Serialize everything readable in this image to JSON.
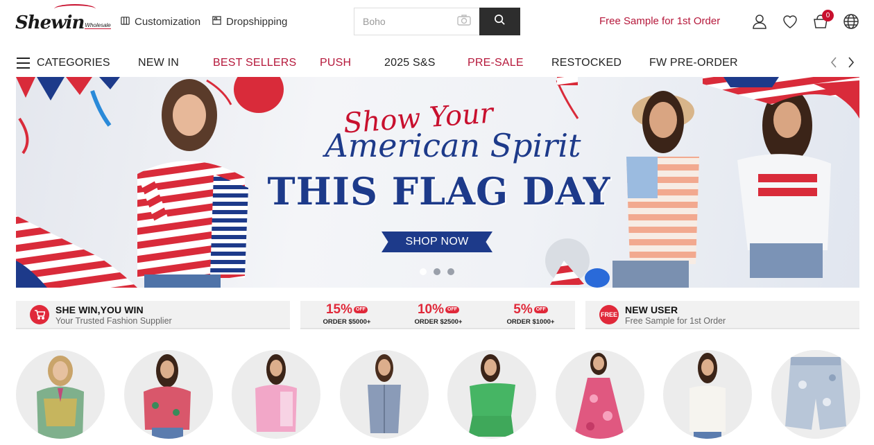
{
  "header": {
    "logo": {
      "main": "Shewin",
      "sub": "Wholesale"
    },
    "links": [
      {
        "label": "Customization",
        "icon": "shirt-icon"
      },
      {
        "label": "Dropshipping",
        "icon": "box-icon"
      }
    ],
    "search": {
      "placeholder": "Boho"
    },
    "free_sample": "Free Sample for 1st Order",
    "cart_count": "0",
    "icons": [
      "user-icon",
      "heart-icon",
      "cart-icon",
      "globe-icon"
    ]
  },
  "nav": {
    "categories_label": "CATEGORIES",
    "items": [
      {
        "label": "NEW IN",
        "highlight": false
      },
      {
        "label": "BEST SELLERS",
        "highlight": true
      },
      {
        "label": "PUSH",
        "highlight": true
      },
      {
        "label": "2025 S&S",
        "highlight": false
      },
      {
        "label": "PRE-SALE",
        "highlight": true
      },
      {
        "label": "RESTOCKED",
        "highlight": false
      },
      {
        "label": "FW PRE-ORDER",
        "highlight": false
      }
    ]
  },
  "banner": {
    "script_line": "Show Your",
    "spirit_line": "American Spirit",
    "headline": "THIS FLAG DAY",
    "cta": "SHOP NOW",
    "slides": 3,
    "active_slide": 1
  },
  "promos": {
    "left": {
      "title": "SHE WIN,YOU WIN",
      "subtitle": "Your Trusted Fashion Supplier",
      "icon": "cart-icon"
    },
    "discounts": [
      {
        "percent": "15%",
        "off": "OFF",
        "order": "ORDER $5000+"
      },
      {
        "percent": "10%",
        "off": "OFF",
        "order": "ORDER $2500+"
      },
      {
        "percent": "5%",
        "off": "OFF",
        "order": "ORDER $1000+"
      }
    ],
    "right": {
      "title": "NEW USER",
      "subtitle": "Free Sample for 1st Order",
      "icon_text": "FREE"
    }
  },
  "colors": {
    "brand_red": "#b5173a",
    "accent_red": "#e0293a",
    "navy": "#1d3a8a",
    "dark": "#2d2d2d"
  }
}
